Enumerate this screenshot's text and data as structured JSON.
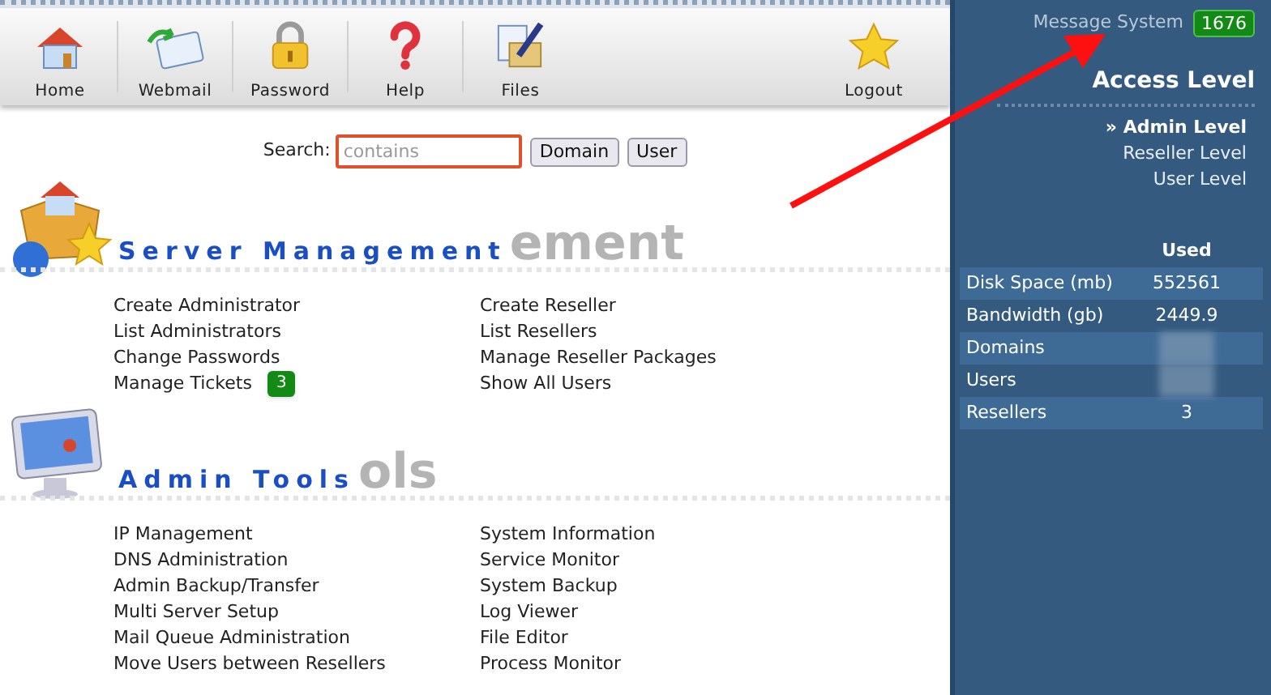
{
  "toolbar": {
    "left": [
      {
        "kind": "home",
        "label": "Home"
      },
      {
        "kind": "mail",
        "label": "Webmail"
      },
      {
        "kind": "lock",
        "label": "Password"
      },
      {
        "kind": "help",
        "label": "Help"
      },
      {
        "kind": "files",
        "label": "Files"
      }
    ],
    "right": [
      {
        "kind": "star",
        "label": "Logout"
      }
    ]
  },
  "search": {
    "label": "Search:",
    "placeholder": "contains",
    "buttons": [
      "Domain",
      "User"
    ]
  },
  "sections": [
    {
      "kind": "server",
      "title": "Server Management",
      "backdrop_tail": "ement",
      "columns": [
        [
          {
            "label": "Create Administrator"
          },
          {
            "label": "List Administrators"
          },
          {
            "label": "Change Passwords"
          },
          {
            "label": "Manage Tickets",
            "badge": "3"
          }
        ],
        [
          {
            "label": "Create Reseller"
          },
          {
            "label": "List Resellers"
          },
          {
            "label": "Manage Reseller Packages"
          },
          {
            "label": "Show All Users"
          }
        ]
      ]
    },
    {
      "kind": "monitor",
      "title": "Admin Tools",
      "backdrop_tail": "ols",
      "columns": [
        [
          {
            "label": "IP Management"
          },
          {
            "label": "DNS Administration"
          },
          {
            "label": "Admin Backup/Transfer"
          },
          {
            "label": "Multi Server Setup"
          },
          {
            "label": "Mail Queue Administration"
          },
          {
            "label": "Move Users between Resellers"
          }
        ],
        [
          {
            "label": "System Information"
          },
          {
            "label": "Service Monitor"
          },
          {
            "label": "System Backup"
          },
          {
            "label": "Log Viewer"
          },
          {
            "label": "File Editor"
          },
          {
            "label": "Process Monitor"
          }
        ]
      ]
    }
  ],
  "sidebar": {
    "message_system": {
      "label": "Message System",
      "count": "1676"
    },
    "access_level": {
      "title": "Access Level",
      "marker": "»",
      "levels": [
        {
          "label": "Admin Level",
          "selected": true
        },
        {
          "label": "Reseller Level",
          "selected": false
        },
        {
          "label": "User Level",
          "selected": false
        }
      ]
    },
    "usage": {
      "header": "Used",
      "rows": [
        {
          "label": "Disk Space (mb)",
          "value": "552561",
          "blurred": false
        },
        {
          "label": "Bandwidth (gb)",
          "value": "2449.9",
          "blurred": false
        },
        {
          "label": "Domains",
          "blurred": true
        },
        {
          "label": "Users",
          "blurred": true
        },
        {
          "label": "Resellers",
          "value": "3",
          "blurred": false
        }
      ]
    }
  },
  "annotation": {
    "arrow": true
  }
}
